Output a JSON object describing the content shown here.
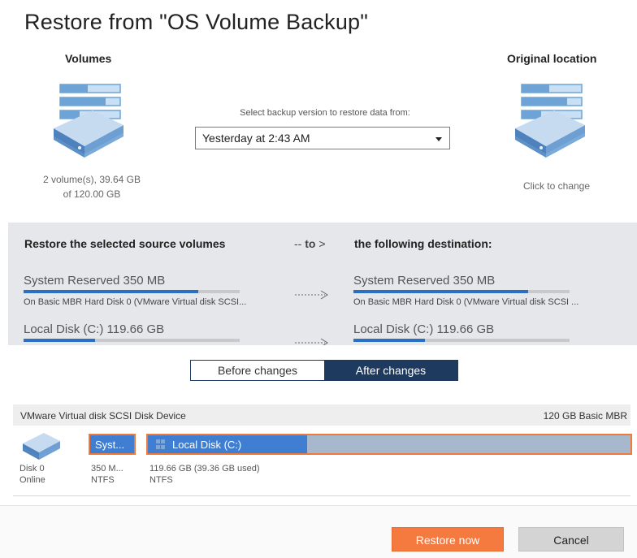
{
  "window": {
    "title": "Restore from \"OS Volume Backup\""
  },
  "source": {
    "label": "Volumes",
    "icon": "server-icon",
    "info_line1": "2 volume(s), 39.64 GB",
    "info_line2": "of 120.00 GB"
  },
  "version": {
    "prompt": "Select backup version to restore data from:",
    "selected": "Yesterday at 2:43 AM"
  },
  "destination": {
    "label": "Original location",
    "icon": "server-icon",
    "action": "Click to change"
  },
  "mapping": {
    "source_heading": "Restore the selected source volumes",
    "to_prefix": "-- ",
    "to_word": "to",
    "to_arrow": " >",
    "destination_heading": "the following destination:",
    "source_volumes": [
      {
        "name": "System Reserved 350 MB",
        "description": "On Basic MBR Hard Disk 0 (VMware Virtual disk SCSI...",
        "used_fraction": 0.81
      },
      {
        "name": "Local Disk (C:) 119.66 GB",
        "description": "",
        "used_fraction": 0.33
      }
    ],
    "destination_volumes": [
      {
        "name": "System Reserved 350 MB",
        "description": "On Basic MBR Hard Disk 0 (VMware Virtual disk SCSI ...",
        "used_fraction": 0.81
      },
      {
        "name": "Local Disk (C:) 119.66 GB",
        "description": "",
        "used_fraction": 0.33
      }
    ]
  },
  "view_toggle": {
    "before": "Before changes",
    "after": "After changes",
    "active": "after"
  },
  "disk": {
    "name": "VMware Virtual disk SCSI Disk Device",
    "size": "120 GB Basic MBR",
    "label": "Disk 0",
    "status": "Online",
    "partitions": [
      {
        "label": "Syst...",
        "size": "350 M...",
        "fs": "NTFS",
        "used_fraction": 1.0
      },
      {
        "label": "Local Disk (C:)",
        "size": "119.66 GB (39.36 GB used)",
        "fs": "NTFS",
        "used_fraction": 0.33
      }
    ]
  },
  "buttons": {
    "restore": "Restore now",
    "cancel": "Cancel"
  },
  "colors": {
    "accent": "#f47a40",
    "bar_fill": "#2b6fc2",
    "toggle_active": "#1e3a5f",
    "partition_used": "#3f7ed0",
    "partition_free": "#a7b8cd",
    "selection_border": "#f07a3a"
  }
}
